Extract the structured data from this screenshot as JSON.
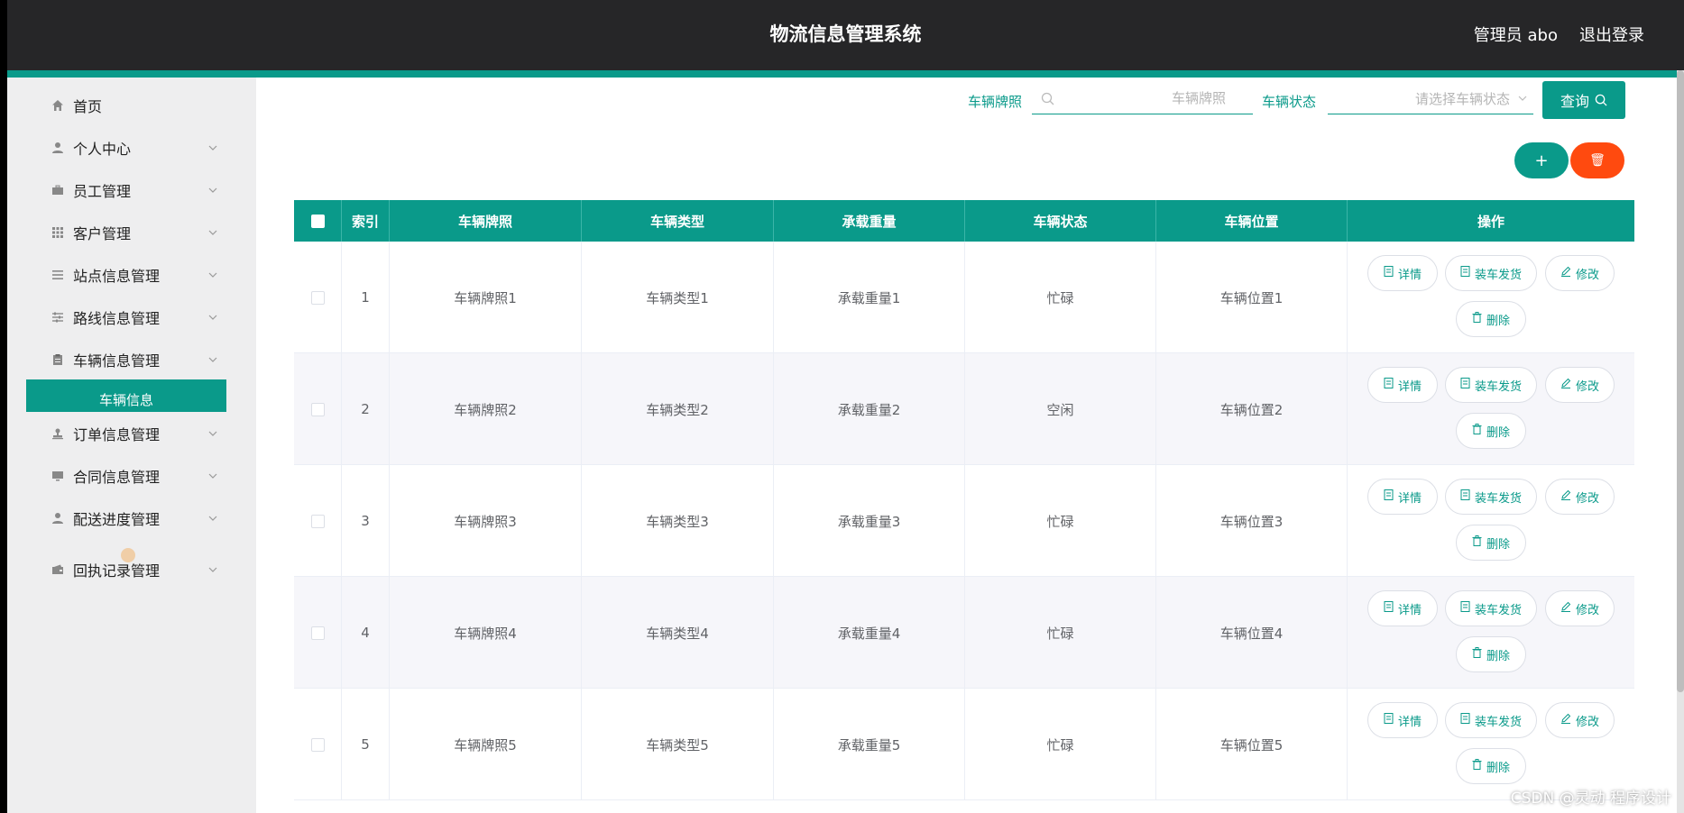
{
  "header": {
    "title": "物流信息管理系统",
    "user": "管理员 abo",
    "logout": "退出登录"
  },
  "sidebar": {
    "items": [
      {
        "label": "首页",
        "icon": "home-icon"
      },
      {
        "label": "个人中心",
        "icon": "user-icon"
      },
      {
        "label": "员工管理",
        "icon": "briefcase-icon"
      },
      {
        "label": "客户管理",
        "icon": "grid-icon"
      },
      {
        "label": "站点信息管理",
        "icon": "list-icon"
      },
      {
        "label": "路线信息管理",
        "icon": "sliders-icon"
      },
      {
        "label": "车辆信息管理",
        "icon": "clipboard-icon"
      },
      {
        "label": "订单信息管理",
        "icon": "stamp-icon"
      },
      {
        "label": "合同信息管理",
        "icon": "monitor-icon"
      },
      {
        "label": "配送进度管理",
        "icon": "user-icon"
      },
      {
        "label": "回执记录管理",
        "icon": "wallet-icon"
      }
    ],
    "active_sub": "车辆信息"
  },
  "search": {
    "plate_label": "车辆牌照",
    "plate_placeholder": "车辆牌照",
    "status_label": "车辆状态",
    "status_placeholder": "请选择车辆状态",
    "query_label": "查询"
  },
  "actions": {
    "add_symbol": "+",
    "delete_symbol": "🗑"
  },
  "table": {
    "headers": [
      "索引",
      "车辆牌照",
      "车辆类型",
      "承载重量",
      "车辆状态",
      "车辆位置",
      "操作"
    ],
    "rows": [
      {
        "index": "1",
        "plate": "车辆牌照1",
        "type": "车辆类型1",
        "weight": "承载重量1",
        "status": "忙碌",
        "location": "车辆位置1"
      },
      {
        "index": "2",
        "plate": "车辆牌照2",
        "type": "车辆类型2",
        "weight": "承载重量2",
        "status": "空闲",
        "location": "车辆位置2"
      },
      {
        "index": "3",
        "plate": "车辆牌照3",
        "type": "车辆类型3",
        "weight": "承载重量3",
        "status": "忙碌",
        "location": "车辆位置3"
      },
      {
        "index": "4",
        "plate": "车辆牌照4",
        "type": "车辆类型4",
        "weight": "承载重量4",
        "status": "忙碌",
        "location": "车辆位置4"
      },
      {
        "index": "5",
        "plate": "车辆牌照5",
        "type": "车辆类型5",
        "weight": "承载重量5",
        "status": "忙碌",
        "location": "车辆位置5"
      }
    ],
    "op_labels": {
      "detail": "详情",
      "ship": "装车发货",
      "edit": "修改",
      "delete": "删除"
    }
  },
  "watermark": "CSDN @灵动 程序设计",
  "colors": {
    "primary": "#0a9a8a",
    "danger": "#ff4a0f",
    "header_bg": "#262628"
  }
}
